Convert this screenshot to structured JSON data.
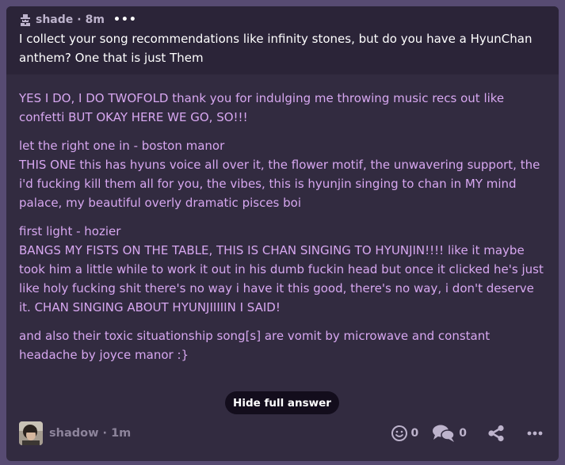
{
  "question": {
    "asker": "shade",
    "time": "8m",
    "text": "I collect your song recommendations like infinity stones, but do you have a HyunChan anthem? One that is just Them"
  },
  "answer": {
    "paragraphs": [
      [
        "YES I DO, I DO TWOFOLD thank you for indulging me throwing music recs out like confetti BUT OKAY HERE WE GO, SO!!!"
      ],
      [
        "let the right one in - boston manor",
        "THIS ONE this has hyuns voice all over it, the flower motif, the unwavering support, the i'd fucking kill them all for you, the vibes, this is hyunjin singing to chan in MY mind palace, my beautiful overly dramatic pisces boi"
      ],
      [
        "first light - hozier",
        "BANGS MY FISTS ON THE TABLE, THIS IS CHAN SINGING TO HYUNJIN!!!! like it maybe took him a little while to work it out in his dumb fuckin head but once it clicked he's just like holy fucking shit there's no way i have it this good, there's no way, i don't deserve it. CHAN SINGING ABOUT HYUNJIIIIIN I SAID!"
      ],
      [
        "and also their toxic situationship song[s] are vomit by microwave and constant headache by joyce manor :}"
      ]
    ],
    "hide_label": "Hide full answer"
  },
  "footer": {
    "answerer": "shadow",
    "time": "1m",
    "reactions_count": "0",
    "replies_count": "0"
  },
  "icons": {
    "asker": "anon-ghost-icon",
    "menu": "more-dots-icon",
    "react": "smiley-icon",
    "reply": "chat-bubbles-icon",
    "share": "share-icon"
  },
  "colors": {
    "background": "#574b72",
    "card": "#322b40",
    "question_bg": "#2b2438",
    "answer_text": "#d7a7f0",
    "button_bg": "#130d1c"
  }
}
